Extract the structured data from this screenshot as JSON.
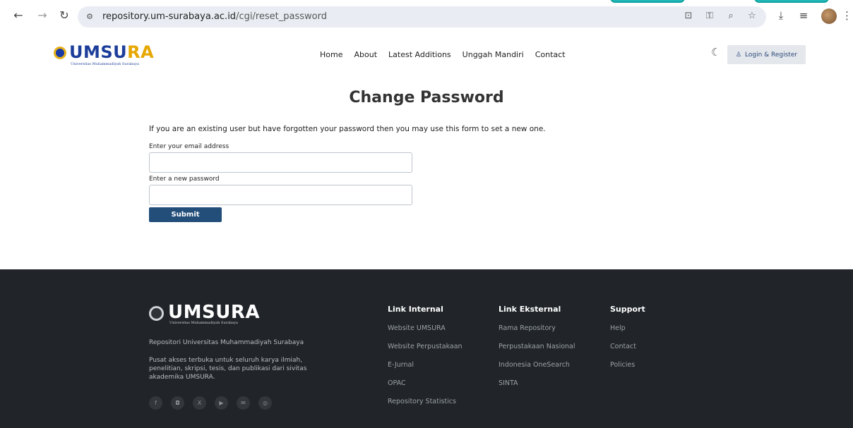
{
  "browser": {
    "url_host": "repository.um-surabaya.ac.id",
    "url_path": "/cgi/reset_password"
  },
  "header": {
    "logo_text_main": "UMSU",
    "logo_text_accent": "RA",
    "logo_subtitle": "Universitas Muhammadiyah Surabaya",
    "nav": [
      "Home",
      "About",
      "Latest Additions",
      "Unggah Mandiri",
      "Contact"
    ],
    "login_label": "Login & Register"
  },
  "main": {
    "title": "Change Password",
    "intro": "If you are an existing user but have forgotten your password then you may use this form to set a new one.",
    "email_label": "Enter your email address",
    "email_value": "",
    "password_label": "Enter a new password",
    "password_value": "",
    "submit_label": "Submit"
  },
  "footer": {
    "logo_text": "UMSURA",
    "logo_subtitle": "Universitas Muhammadiyah Surabaya",
    "tagline": "Repositori Universitas Muhammadiyah Surabaya",
    "description": "Pusat akses terbuka untuk seluruh karya ilmiah, penelitian, skripsi, tesis, dan publikasi dari sivitas akademika UMSURA.",
    "socials": [
      "facebook-icon",
      "instagram-icon",
      "x-icon",
      "youtube-icon",
      "email-icon",
      "globe-icon"
    ],
    "columns": [
      {
        "heading": "Link Internal",
        "links": [
          "Website UMSURA",
          "Website Perpustakaan",
          "E-Jurnal",
          "OPAC",
          "Repository Statistics"
        ]
      },
      {
        "heading": "Link Eksternal",
        "links": [
          "Rama Repository",
          "Perpustakaan Nasional",
          "Indonesia OneSearch",
          "SINTA"
        ]
      },
      {
        "heading": "Support",
        "links": [
          "Help",
          "Contact",
          "Policies"
        ]
      }
    ]
  },
  "colors": {
    "brand_blue": "#1d3d9a",
    "brand_gold": "#e6a700",
    "submit_bg": "#234e7a",
    "footer_bg": "#212529"
  }
}
